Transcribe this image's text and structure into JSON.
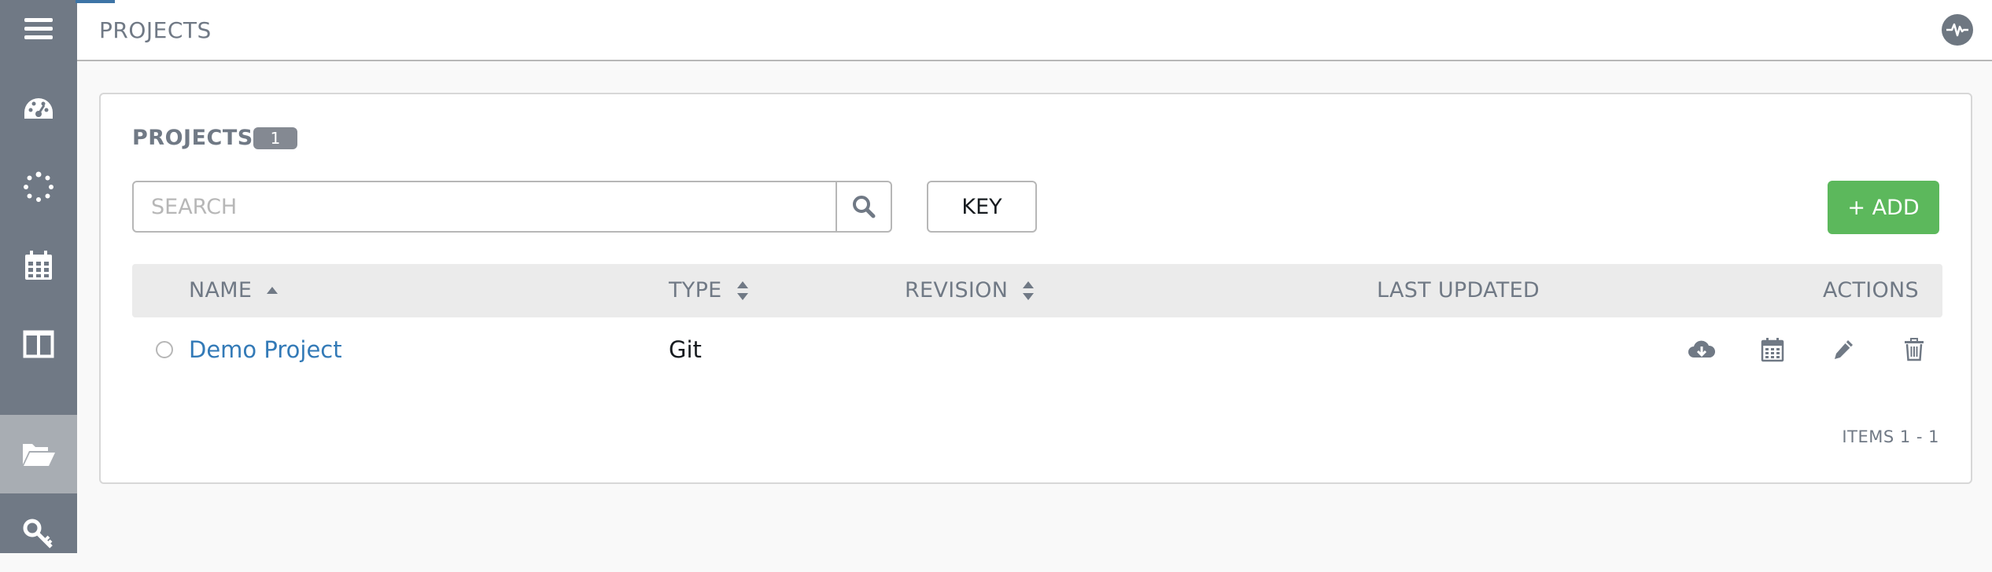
{
  "nav": {
    "items": [
      {
        "name": "menu",
        "icon": "hamburger-icon"
      },
      {
        "name": "dashboard",
        "icon": "dashboard-gauge-icon"
      },
      {
        "name": "jobs",
        "icon": "spinner-icon"
      },
      {
        "name": "schedules",
        "icon": "calendar-icon"
      },
      {
        "name": "portal",
        "icon": "columns-icon"
      },
      {
        "name": "projects",
        "icon": "folder-open-icon",
        "active": true
      },
      {
        "name": "credentials",
        "icon": "key-icon"
      }
    ]
  },
  "header": {
    "breadcrumb": "PROJECTS",
    "activity_icon": "activity-stream-icon"
  },
  "panel": {
    "title": "PROJECTS",
    "count": "1",
    "search_placeholder": "SEARCH",
    "key_label": "KEY",
    "add_label": "+ ADD"
  },
  "table": {
    "columns": {
      "name": "NAME",
      "type": "TYPE",
      "revision": "REVISION",
      "last_updated": "LAST UPDATED",
      "actions": "ACTIONS"
    },
    "rows": [
      {
        "name": "Demo Project",
        "type": "Git",
        "revision": "",
        "last_updated": "",
        "actions": [
          "cloud-download-icon",
          "calendar-icon",
          "pencil-icon",
          "trash-icon"
        ]
      }
    ],
    "items_label": "ITEMS  1 - 1"
  },
  "colors": {
    "sidebar": "#707985",
    "sidebar_active": "#a8adb3",
    "add_button": "#5cb85c",
    "link": "#337ab7",
    "header_row": "#ebebeb"
  }
}
